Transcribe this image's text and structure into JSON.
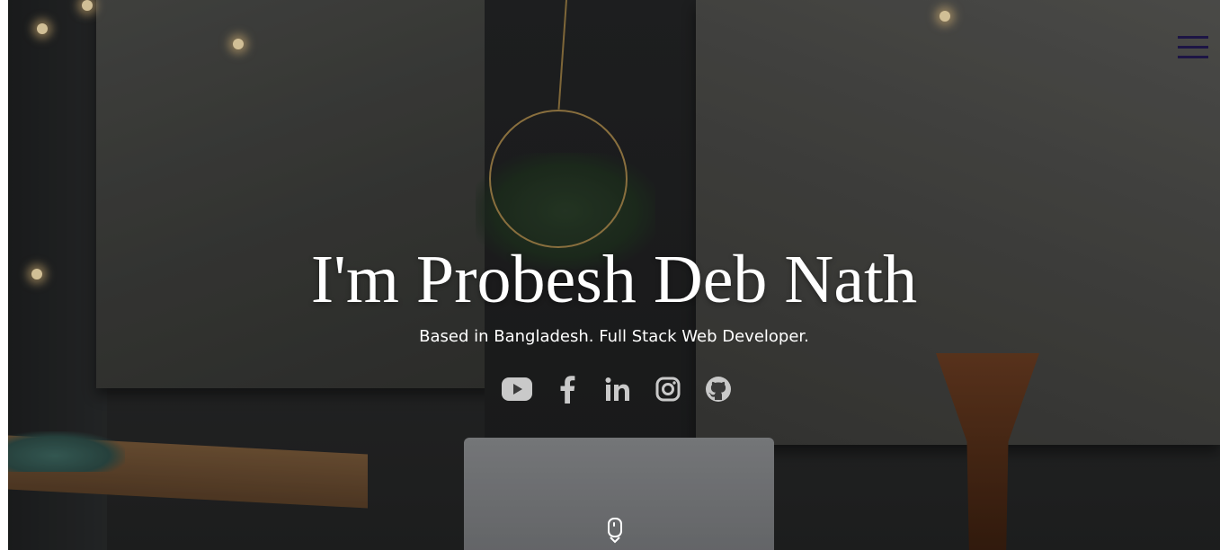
{
  "hero": {
    "title": "I'm Probesh Deb Nath",
    "subtitle": "Based in Bangladesh. Full Stack Web Developer."
  },
  "menu": {
    "icon": "hamburger-icon",
    "color": "#1d1545"
  },
  "social": [
    {
      "name": "youtube",
      "icon": "youtube-icon"
    },
    {
      "name": "facebook",
      "icon": "facebook-icon"
    },
    {
      "name": "linkedin",
      "icon": "linkedin-icon"
    },
    {
      "name": "instagram",
      "icon": "instagram-icon"
    },
    {
      "name": "github",
      "icon": "github-icon"
    }
  ],
  "scroll_indicator": {
    "icon": "mouse-scroll-icon"
  },
  "colors": {
    "text": "#ffffff",
    "social_icon": "#c9c9c9",
    "menu": "#1d1545"
  }
}
